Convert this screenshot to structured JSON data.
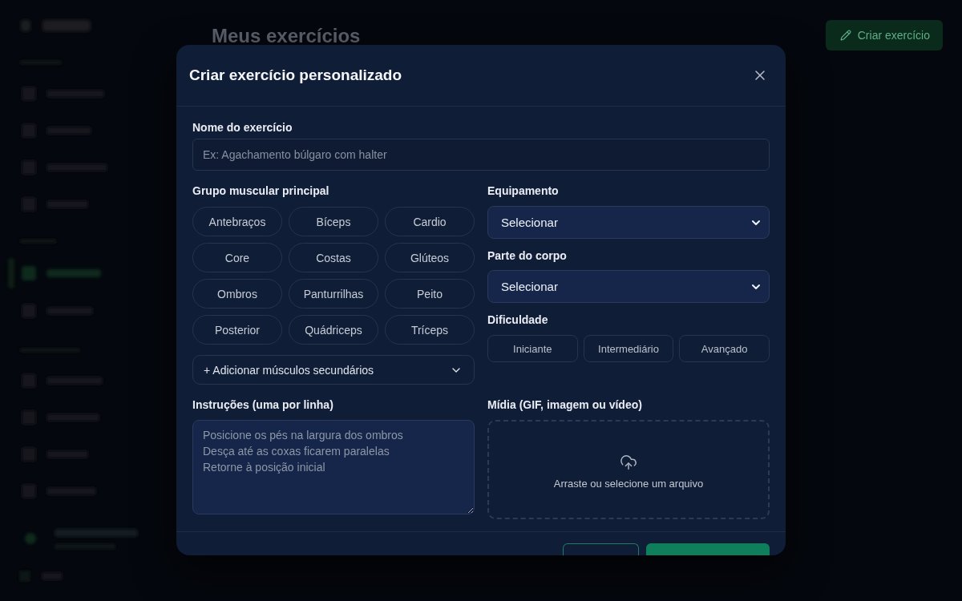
{
  "background": {
    "page_title": "Meus exercícios",
    "create_button": "Criar exercício"
  },
  "dialog": {
    "title": "Criar exercício personalizado",
    "name_field": {
      "label": "Nome do exercício",
      "placeholder": "Ex: Agachamento búlgaro com halter"
    },
    "muscle_group": {
      "label": "Grupo muscular principal",
      "options": [
        {
          "label": "Antebraços",
          "selected": false
        },
        {
          "label": "Bíceps",
          "selected": false
        },
        {
          "label": "Cardio",
          "selected": false
        },
        {
          "label": "Core",
          "selected": false
        },
        {
          "label": "Costas",
          "selected": false
        },
        {
          "label": "Glúteos",
          "selected": false
        },
        {
          "label": "Ombros",
          "selected": false
        },
        {
          "label": "Panturrilhas",
          "selected": false
        },
        {
          "label": "Peito",
          "selected": false
        },
        {
          "label": "Posterior",
          "selected": false
        },
        {
          "label": "Quádriceps",
          "selected": false
        },
        {
          "label": "Tríceps",
          "selected": false
        }
      ],
      "secondary_toggle": "+ Adicionar músculos secundários"
    },
    "equipment": {
      "label": "Equipamento",
      "value": "Selecionar"
    },
    "body_part": {
      "label": "Parte do corpo",
      "value": "Selecionar"
    },
    "difficulty": {
      "label": "Dificuldade",
      "options": [
        {
          "label": "Iniciante",
          "selected": false
        },
        {
          "label": "Intermediário",
          "selected": false
        },
        {
          "label": "Avançado",
          "selected": false
        }
      ]
    },
    "instructions": {
      "label": "Instruções (uma por linha)",
      "placeholder": "Posicione os pés na largura dos ombros\nDesça até as coxas ficarem paralelas\nRetorne à posição inicial"
    },
    "media": {
      "label": "Mídia (GIF, imagem ou vídeo)",
      "hint": "Arraste ou selecione um arquivo"
    }
  }
}
